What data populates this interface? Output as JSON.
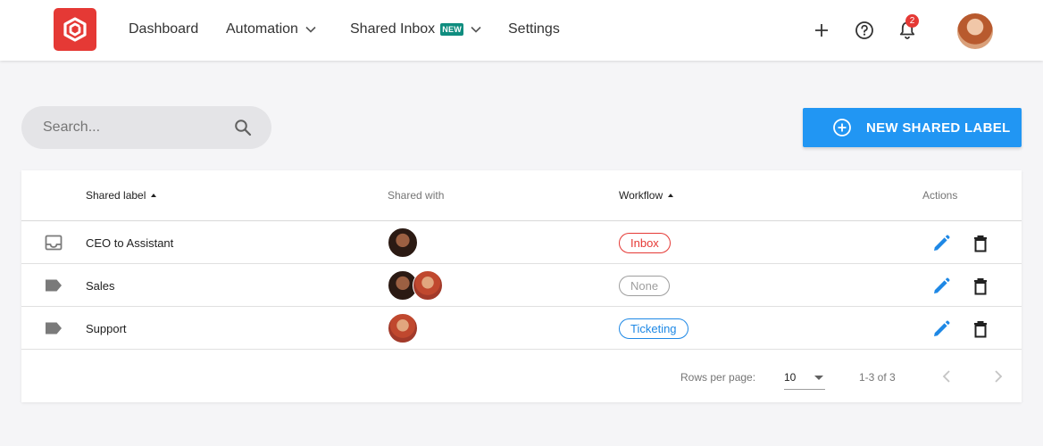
{
  "nav": {
    "items": [
      {
        "label": "Dashboard"
      },
      {
        "label": "Automation"
      },
      {
        "label": "Shared Inbox",
        "badge": "NEW"
      },
      {
        "label": "Settings"
      }
    ],
    "notification_count": "2"
  },
  "search": {
    "placeholder": "Search..."
  },
  "new_label_button": "NEW SHARED LABEL",
  "table": {
    "columns": {
      "label": "Shared label",
      "shared_with": "Shared with",
      "workflow": "Workflow",
      "actions": "Actions"
    },
    "rows": [
      {
        "icon": "inbox-tray-icon",
        "label": "CEO to Assistant",
        "workflow": "Inbox",
        "workflow_color": "#e53935"
      },
      {
        "icon": "label-tag-icon",
        "label": "Sales",
        "workflow": "None",
        "workflow_color": "#9e9e9e"
      },
      {
        "icon": "label-tag-icon",
        "label": "Support",
        "workflow": "Ticketing",
        "workflow_color": "#1e88e5"
      }
    ],
    "footer": {
      "rows_per_page_label": "Rows per page:",
      "rows_per_page": "10",
      "range": "1-3 of 3"
    }
  },
  "colors": {
    "accent": "#2196f3",
    "brand": "#e53935"
  }
}
